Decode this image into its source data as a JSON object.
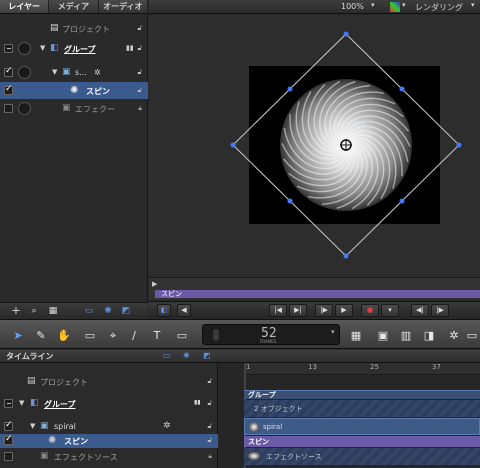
{
  "left_panel": {
    "tabs": [
      "レイヤー",
      "メディア",
      "オーディオ"
    ],
    "rows": [
      {
        "label": "プロジェクト"
      },
      {
        "label": "グループ"
      },
      {
        "label": "s..."
      },
      {
        "label": "スピン"
      },
      {
        "label": "エフェクー"
      }
    ]
  },
  "canvas_bar": {
    "zoom": "100%",
    "rendering": "レンダリング"
  },
  "mini_timeline": {
    "spin_label": "スピン"
  },
  "frame_display": {
    "value": "52",
    "unit": "FRAMES"
  },
  "timeline": {
    "title": "タイムライン",
    "ruler": [
      "1",
      "13",
      "25",
      "37"
    ],
    "rows": [
      {
        "label": "プロジェクト"
      },
      {
        "label": "グループ"
      },
      {
        "label": "spiral"
      },
      {
        "label": "スピン"
      },
      {
        "label": "エフェクトソース"
      }
    ],
    "bars": {
      "group": "グループ",
      "objects": "2 オブジェクト",
      "spiral": "spiral",
      "spin": "スピン",
      "effect_source": "エフェクトソース"
    }
  },
  "colors": {
    "selection": "#3b5b8f",
    "spin_bar": "#6b5ba6",
    "track_bar": "#3e5a86",
    "playhead": "#e03030"
  }
}
